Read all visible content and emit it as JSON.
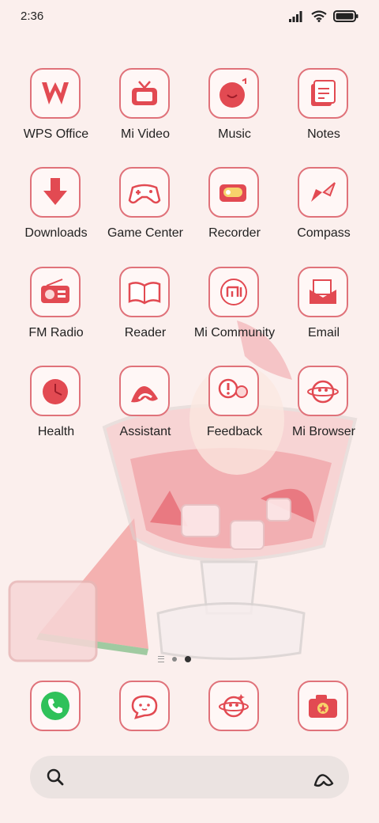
{
  "status": {
    "time": "2:36"
  },
  "apps": [
    {
      "label": "WPS Office",
      "icon": "wps-office-icon"
    },
    {
      "label": "Mi Video",
      "icon": "mi-video-icon"
    },
    {
      "label": "Music",
      "icon": "music-icon"
    },
    {
      "label": "Notes",
      "icon": "notes-icon"
    },
    {
      "label": "Downloads",
      "icon": "downloads-icon"
    },
    {
      "label": "Game Center",
      "icon": "game-center-icon"
    },
    {
      "label": "Recorder",
      "icon": "recorder-icon"
    },
    {
      "label": "Compass",
      "icon": "compass-icon"
    },
    {
      "label": "FM Radio",
      "icon": "fm-radio-icon"
    },
    {
      "label": "Reader",
      "icon": "reader-icon"
    },
    {
      "label": "Mi Community",
      "icon": "mi-community-icon"
    },
    {
      "label": "Email",
      "icon": "email-icon"
    },
    {
      "label": "Health",
      "icon": "health-icon"
    },
    {
      "label": "Assistant",
      "icon": "assistant-app-icon"
    },
    {
      "label": "Feedback",
      "icon": "feedback-icon"
    },
    {
      "label": "Mi Browser",
      "icon": "mi-browser-icon"
    }
  ],
  "dock": [
    {
      "icon": "phone-icon"
    },
    {
      "icon": "messages-icon"
    },
    {
      "icon": "browser-planet-icon"
    },
    {
      "icon": "camera-icon"
    }
  ],
  "colors": {
    "accent": "#e0727a",
    "background": "#fbefed",
    "phone_green": "#2fc15a"
  }
}
